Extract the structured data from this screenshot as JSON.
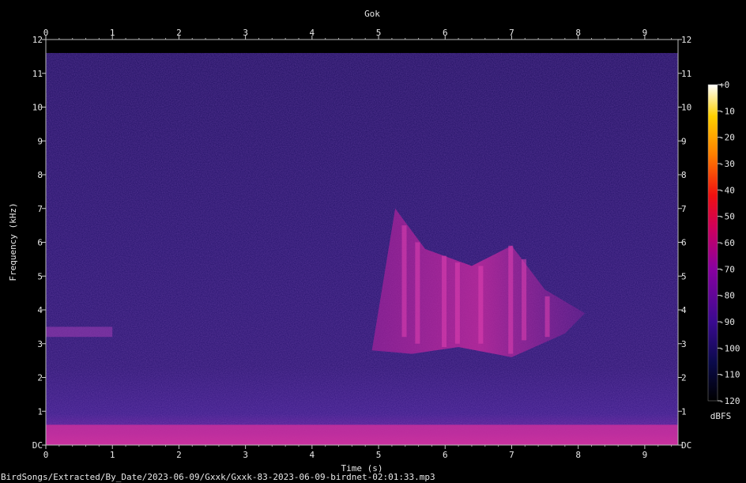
{
  "chart_data": {
    "type": "heatmap",
    "title": "Gok",
    "xlabel": "Time (s)",
    "ylabel": "Frequency (kHz)",
    "xlim": [
      0,
      9.5
    ],
    "ylim": [
      0,
      12
    ],
    "x_ticks": [
      "0",
      "1",
      "2",
      "3",
      "4",
      "5",
      "6",
      "7",
      "8",
      "9"
    ],
    "y_ticks": [
      "DC",
      "1",
      "2",
      "3",
      "4",
      "5",
      "6",
      "7",
      "8",
      "9",
      "10",
      "11",
      "12"
    ],
    "colorbar": {
      "label": "dBFS",
      "ticks": [
        "+0",
        "-10",
        "-20",
        "-30",
        "-40",
        "-50",
        "-60",
        "-70",
        "-80",
        "-90",
        "-100",
        "-110",
        "-120"
      ],
      "range": [
        -120,
        0
      ]
    },
    "background_upper_limit_khz": 11.6,
    "features": [
      {
        "name": "call-sweep",
        "t_start": 5.0,
        "t_end": 8.1,
        "f_low": 2.5,
        "f_high": 7.0,
        "level_db": -78
      },
      {
        "name": "low-tone-left",
        "t_start": 0.0,
        "t_end": 1.0,
        "f_low": 3.2,
        "f_high": 3.5,
        "level_db": -90
      },
      {
        "name": "dc-band",
        "t_start": 0.0,
        "t_end": 9.5,
        "f_low": 0.0,
        "f_high": 0.6,
        "level_db": -80
      }
    ],
    "colors": {
      "low": "#000000",
      "mid_low": "#1a0a5c",
      "mid": "#8a00a0",
      "mid_high": "#e8002a",
      "high": "#ffd000",
      "top": "#ffffff"
    }
  },
  "footer": "BirdSongs/Extracted/By_Date/2023-06-09/Gxxk/Gxxk-83-2023-06-09-birdnet-02:01:33.mp3"
}
